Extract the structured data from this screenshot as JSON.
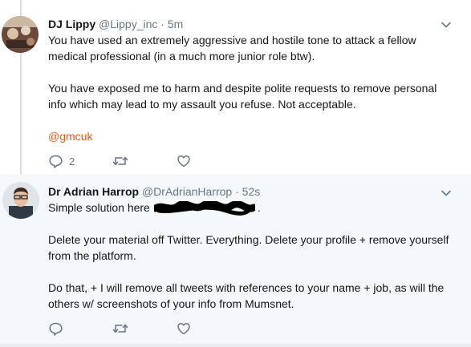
{
  "tweets": [
    {
      "name": "DJ Lippy",
      "handle": "@Lippy_inc",
      "separator": "·",
      "time": "5m",
      "paragraphs": [
        "You have used an extremely aggressive and hostile tone to attack a fellow medical professional (in a much more junior role btw).",
        "You have exposed me to harm and despite polite requests to remove personal info which may lead to my assault you refuse. Not acceptable."
      ],
      "mention": "@gmcuk",
      "reply_count": "2",
      "retweet_count": "",
      "like_count": ""
    },
    {
      "name": "Dr Adrian Harrop",
      "handle": "@DrAdrianHarrop",
      "separator": "·",
      "time": "52s",
      "line1_start": "Simple solution here",
      "line1_end": ".",
      "paragraphs": [
        "Delete your material off Twitter. Everything. Delete your profile + remove yourself from the platform.",
        "Do that, + I will remove all tweets with references to your name + job, as will the others w/ screenshots of your info from Mumsnet."
      ],
      "reply_count": "",
      "retweet_count": "",
      "like_count": ""
    }
  ],
  "icons": {
    "reply": "reply-icon",
    "retweet": "retweet-icon",
    "like": "heart-icon",
    "more": "chevron-down-icon"
  },
  "colors": {
    "text": "#14171a",
    "secondary": "#657786",
    "mention": "#e25d1a",
    "selected_bg": "#f5f8fa"
  }
}
